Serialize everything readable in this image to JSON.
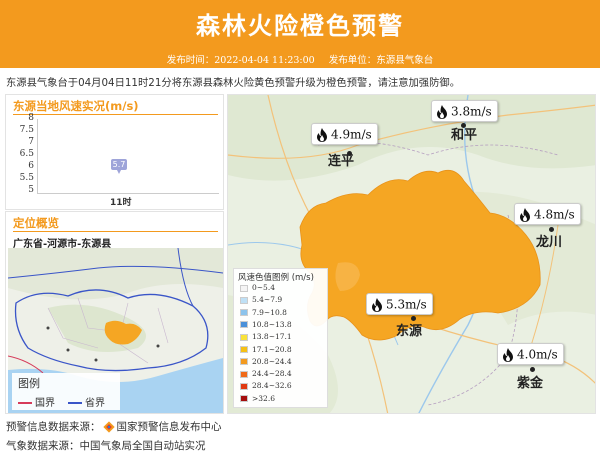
{
  "header": {
    "title": "森林火险橙色预警",
    "publish_time_label": "发布时间：2022-04-04 11:23:00",
    "publisher_label": "发布单位：东源县气象台"
  },
  "description": "东源县气象台于04月04日11时21分将东源县森林火险黄色预警升级为橙色预警，请注意加强防御。",
  "wind_panel": {
    "title": "东源当地风速实况(m/s)",
    "chart_data": {
      "type": "scatter",
      "categories": [
        "11时"
      ],
      "values": [
        5.7
      ],
      "ylabels": [
        "8",
        "7.5",
        "7",
        "6.5",
        "6",
        "5.5",
        "5"
      ],
      "ylim": [
        5,
        8
      ],
      "data_label": "5.7",
      "x_label": "11时"
    }
  },
  "location_panel": {
    "title": "定位概览",
    "path": "广东省-河源市-东源县",
    "legend_title": "图例",
    "legend_items": [
      {
        "label": "国界",
        "color": "#d63b5a"
      },
      {
        "label": "省界",
        "color": "#3a55c8"
      }
    ]
  },
  "main_map": {
    "stations": [
      {
        "name": "连平",
        "speed": "4.9m/s"
      },
      {
        "name": "和平",
        "speed": "3.8m/s"
      },
      {
        "name": "龙川",
        "speed": "4.8m/s"
      },
      {
        "name": "东源",
        "speed": "5.3m/s"
      },
      {
        "name": "紫金",
        "speed": "4.0m/s"
      }
    ],
    "legend": {
      "title": "风速色值图例 (m/s)",
      "items": [
        {
          "label": "0~5.4",
          "color": "#f5f5f5"
        },
        {
          "label": "5.4~7.9",
          "color": "#bfe0f5"
        },
        {
          "label": "7.9~10.8",
          "color": "#8cc3ec"
        },
        {
          "label": "10.8~13.8",
          "color": "#4a90d9"
        },
        {
          "label": "13.8~17.1",
          "color": "#f9e23a"
        },
        {
          "label": "17.1~20.8",
          "color": "#f5c015"
        },
        {
          "label": "20.8~24.4",
          "color": "#f39a1e"
        },
        {
          "label": "24.4~28.4",
          "color": "#f06a1a"
        },
        {
          "label": "28.4~32.6",
          "color": "#e03a12"
        },
        {
          "label": ">32.6",
          "color": "#a50d0d"
        }
      ]
    }
  },
  "sources": {
    "warning_source": "预警信息数据来源：",
    "warning_source_name": "国家预警信息发布中心",
    "weather_source": "气象数据来源：中国气象局全国自动站实况"
  },
  "colors": {
    "accent": "#f39a1e",
    "fill_orange": "#f5a623"
  },
  "icons": [
    "fire-icon",
    "warning-logo-icon"
  ]
}
